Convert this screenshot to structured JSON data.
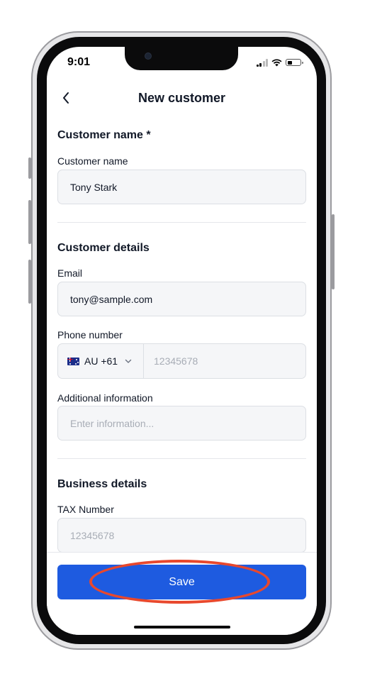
{
  "status_bar": {
    "time": "9:01"
  },
  "nav": {
    "title": "New customer"
  },
  "customer_name_section": {
    "title": "Customer name *",
    "field_label": "Customer name",
    "field_value": "Tony Stark"
  },
  "customer_details_section": {
    "title": "Customer details",
    "email_label": "Email",
    "email_value": "tony@sample.com",
    "phone_label": "Phone number",
    "country_code": "AU +61",
    "phone_placeholder": "12345678",
    "additional_label": "Additional information",
    "additional_placeholder": "Enter information..."
  },
  "business_details_section": {
    "title": "Business details",
    "tax_label": "TAX Number",
    "tax_placeholder": "12345678"
  },
  "footer": {
    "save_label": "Save"
  },
  "colors": {
    "primary": "#1e5be0",
    "highlight": "#e8482d",
    "input_bg": "#f5f6f8"
  }
}
